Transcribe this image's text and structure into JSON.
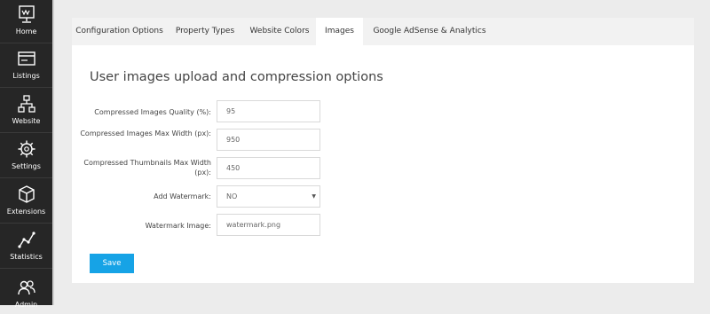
{
  "sidebar": {
    "items": [
      {
        "label": "Home",
        "icon": "home-monitor-icon"
      },
      {
        "label": "Listings",
        "icon": "listings-card-icon"
      },
      {
        "label": "Website",
        "icon": "website-sitemap-icon"
      },
      {
        "label": "Settings",
        "icon": "settings-gear-icon"
      },
      {
        "label": "Extensions",
        "icon": "extensions-cube-icon"
      },
      {
        "label": "Statistics",
        "icon": "statistics-chart-icon"
      },
      {
        "label": "Admin",
        "icon": "admin-users-icon"
      }
    ]
  },
  "tabs": [
    {
      "label": "Configuration Options"
    },
    {
      "label": "Property Types"
    },
    {
      "label": "Website Colors"
    },
    {
      "label": "Images",
      "active": true
    },
    {
      "label": "Google AdSense & Analytics"
    }
  ],
  "form": {
    "heading": "User images upload and compression options",
    "fields": [
      {
        "label": "Compressed Images Quality (%):",
        "value": "95"
      },
      {
        "label": "Compressed Images Max Width (px):",
        "value": "950"
      },
      {
        "label": "Compressed Thumbnails Max Width (px):",
        "value": "450"
      },
      {
        "label": "Add Watermark:",
        "value": "NO",
        "type": "select"
      },
      {
        "label": "Watermark Image:",
        "value": "watermark.png"
      }
    ],
    "save_label": "Save"
  },
  "colors": {
    "sidebar_bg": "#262626",
    "accent": "#16a3e6",
    "page_bg": "#ececec"
  }
}
